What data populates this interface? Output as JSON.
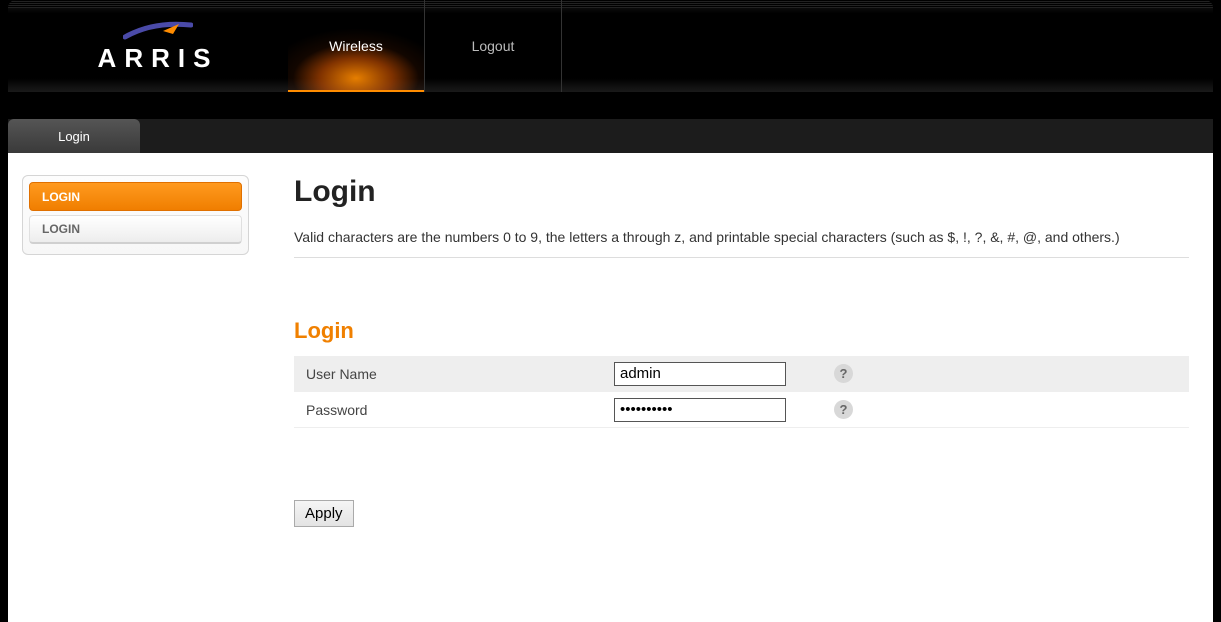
{
  "brand": "ARRIS",
  "nav": {
    "items": [
      {
        "label": "Wireless"
      },
      {
        "label": "Logout"
      }
    ]
  },
  "subnav": {
    "items": [
      {
        "label": "Login"
      }
    ]
  },
  "sidebar": {
    "items": [
      {
        "label": "LOGIN"
      },
      {
        "label": "LOGIN"
      }
    ]
  },
  "page": {
    "title": "Login",
    "description": "Valid characters are the numbers 0 to 9, the letters a through z, and printable special characters (such as $, !, ?, &, #, @, and others.)"
  },
  "section": {
    "title": "Login"
  },
  "form": {
    "username_label": "User Name",
    "username_value": "admin",
    "password_label": "Password",
    "password_value": "••••••••••",
    "apply_label": "Apply"
  }
}
